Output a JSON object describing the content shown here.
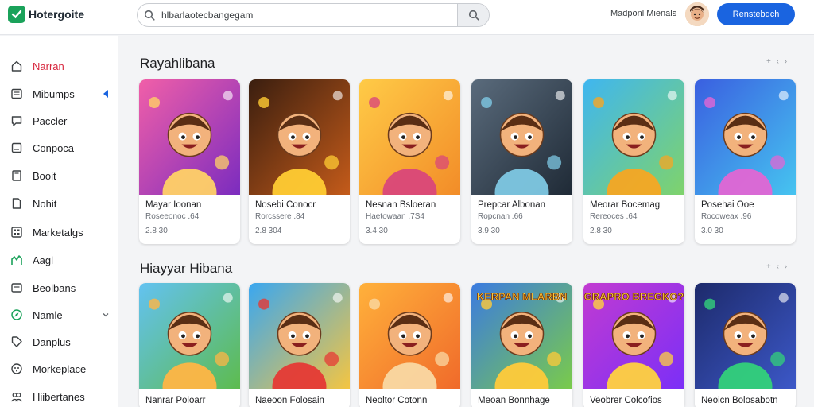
{
  "app": {
    "name": "Hotergoite",
    "brand_color": "#1aa25a",
    "accent_color": "#1a64e0",
    "active_color": "#d7263d"
  },
  "search": {
    "value": "hlbarlaotecbangegam",
    "search_icon": "search-icon"
  },
  "header": {
    "user_name": "Madponl Mienals",
    "primary_button": "Renstebdch"
  },
  "sidebar": {
    "items": [
      {
        "label": "Narran",
        "icon": "home-icon",
        "active": true
      },
      {
        "label": "Mibumps",
        "icon": "apps-icon"
      },
      {
        "label": "Paccler",
        "icon": "chat-icon"
      },
      {
        "label": "Conpoca",
        "icon": "folder-icon"
      },
      {
        "label": "Booit",
        "icon": "book-icon"
      },
      {
        "label": "Nohit",
        "icon": "document-icon"
      },
      {
        "label": "Marketalgs",
        "icon": "grid-icon"
      },
      {
        "label": "Aagl",
        "icon": "chart-icon"
      },
      {
        "label": "Beolbans",
        "icon": "card-icon"
      },
      {
        "label": "Namle",
        "icon": "compass-icon"
      },
      {
        "label": "Danplus",
        "icon": "tag-icon"
      },
      {
        "label": "Morkeplace",
        "icon": "gamepad-icon"
      },
      {
        "label": "Hiibertanes",
        "icon": "people-icon"
      }
    ]
  },
  "sections": [
    {
      "title": "Rayahlibana",
      "controls": "+ ‹ ›",
      "cards": [
        {
          "title": "Mayar Ioonan",
          "subtitle": "Roseeonoc .64",
          "meta": "2.8 30",
          "bg": [
            "#f15fa8",
            "#7b2cbf"
          ],
          "accent": "#ffd166"
        },
        {
          "title": "Nosebi Conocr",
          "subtitle": "Rorcssere .84",
          "meta": "2.8 304",
          "bg": [
            "#3a1e0f",
            "#c45b1a"
          ],
          "accent": "#ffcc33"
        },
        {
          "title": "Nesnan Bsloeran",
          "subtitle": "Haetowaan .7S4",
          "meta": "3.4 30",
          "bg": [
            "#ffcb47",
            "#f28c28"
          ],
          "accent": "#d9477a"
        },
        {
          "title": "Prepcar Albonan",
          "subtitle": "Ropcnan .66",
          "meta": "3.9 30",
          "bg": [
            "#5a6b7c",
            "#1f2a36"
          ],
          "accent": "#7ec8e3"
        },
        {
          "title": "Meorar Bocemag",
          "subtitle": "Rereoces .64",
          "meta": "2.8 30",
          "bg": [
            "#3fb6f0",
            "#7fd36b"
          ],
          "accent": "#f6a623"
        },
        {
          "title": "Posehai Ooe",
          "subtitle": "Rocoweax .96",
          "meta": "3.0 30",
          "bg": [
            "#3a5fe0",
            "#46c4f0"
          ],
          "accent": "#e266d4"
        }
      ]
    },
    {
      "title": "Hiayyar Hibana",
      "controls": "+ ‹ ›",
      "cards": [
        {
          "title": "Nanrar Poloarr",
          "bg": [
            "#63c2f1",
            "#5dbb4e"
          ],
          "accent": "#ffb545"
        },
        {
          "title": "Naeoon Folosain",
          "bg": [
            "#3aa7f0",
            "#f4c542"
          ],
          "accent": "#e53935"
        },
        {
          "title": "Neoltor Cotonn",
          "bg": [
            "#ffb13b",
            "#f06a2a"
          ],
          "accent": "#f9d8a3"
        },
        {
          "title": "Meoan Bonnhage",
          "bg": [
            "#3b7be0",
            "#7acb4a"
          ],
          "accent": "#ffca3a",
          "banner": "KERPAN MLARBN"
        },
        {
          "title": "Veobrer Colcofios",
          "bg": [
            "#c23bd1",
            "#7b2ff7"
          ],
          "accent": "#ffd23f",
          "banner": "GRAPRO BREGKO?"
        },
        {
          "title": "Neoicn Bolosabotn",
          "bg": [
            "#1d2a6b",
            "#3c58c8"
          ],
          "accent": "#33d17a"
        }
      ]
    }
  ]
}
